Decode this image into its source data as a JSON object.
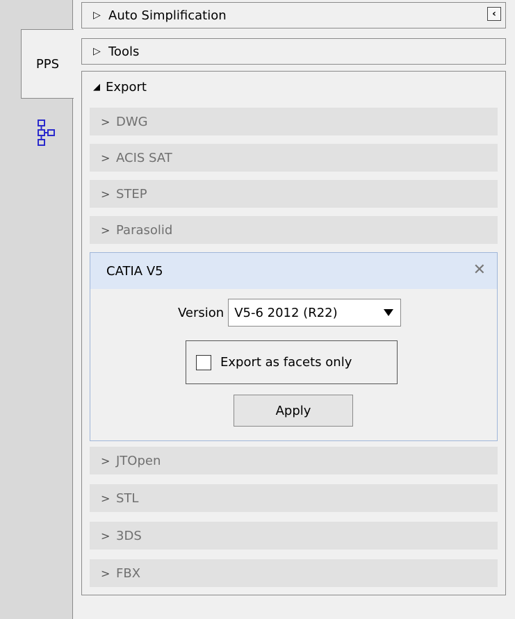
{
  "tabs": {
    "pps_label": "PPS",
    "second_icon": "tree-structure-icon"
  },
  "sections": {
    "auto_simplification": "Auto Simplification",
    "tools": "Tools",
    "export": "Export"
  },
  "export_items_top": [
    "DWG",
    "ACIS SAT",
    "STEP",
    "Parasolid"
  ],
  "catia": {
    "title": "CATIA V5",
    "version_label": "Version",
    "version_value": "V5-6 2012 (R22)",
    "facets_label": "Export as facets only",
    "facets_checked": false,
    "apply_label": "Apply"
  },
  "export_items_bottom": [
    "JTOpen",
    "STL",
    "3DS",
    "FBX"
  ],
  "colors": {
    "panel_bg": "#f0f0f0",
    "item_bg": "#e1e1e1",
    "active_header_bg": "#dde7f6",
    "active_border": "#9fb6d9"
  }
}
